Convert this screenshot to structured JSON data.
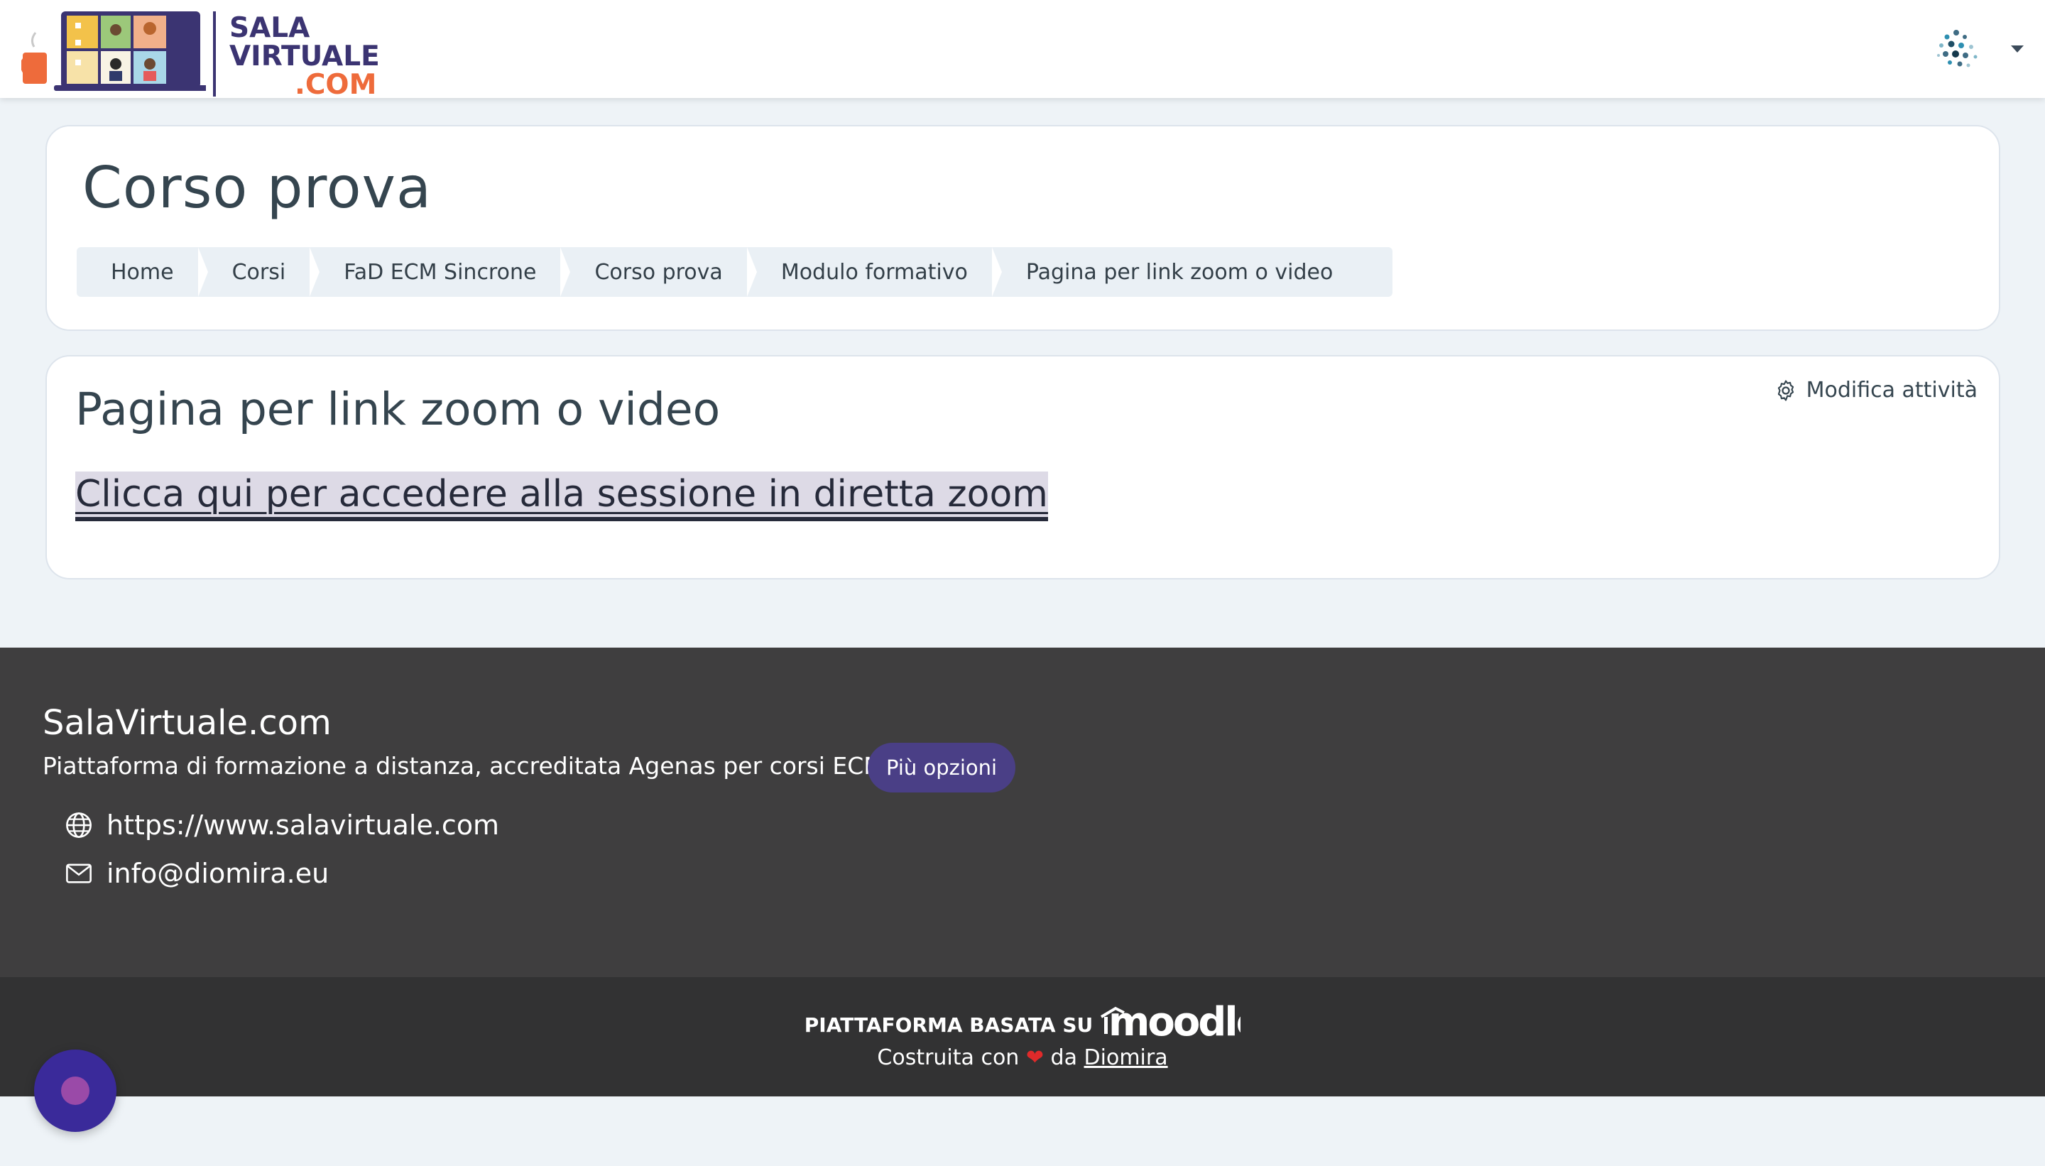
{
  "site": {
    "logo_lines": [
      "SALA",
      "VIRTUALE",
      ".COM"
    ]
  },
  "header": {
    "course_title": "Corso prova",
    "breadcrumb": [
      "Home",
      "Corsi",
      "FaD ECM Sincrone",
      "Corso prova",
      "Modulo formativo",
      "Pagina per link zoom o video"
    ]
  },
  "activity": {
    "title": "Pagina per link zoom o video",
    "edit_label": "Modifica attività",
    "link_text": "Clicca qui per accedere alla sessione in diretta zoom"
  },
  "footer": {
    "title": "SalaVirtuale.com",
    "description": "Piattaforma di formazione a distanza, accreditata Agenas per corsi ECM",
    "more_options": "Più opzioni",
    "website": "https://www.salavirtuale.com",
    "email": "info@diomira.eu",
    "powered_by": "PIATTAFORMA BASATA SU",
    "moodle_wordmark": "moodle",
    "built_with": "Costruita con",
    "built_by_prefix": "da",
    "built_by": "Diomira"
  },
  "colors": {
    "brand_purple": "#3b3472",
    "brand_orange": "#ee6b3b",
    "footer_bg": "#3f3e3f",
    "footer_bottom_bg": "#323233",
    "button_purple": "#4a3f86"
  }
}
